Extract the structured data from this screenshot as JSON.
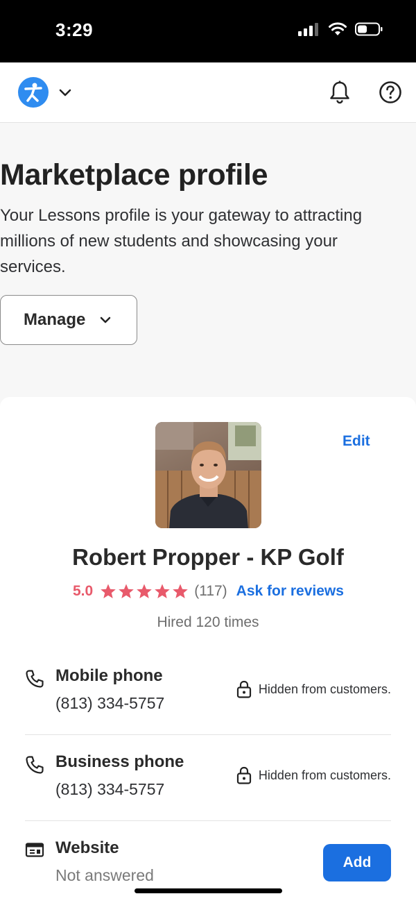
{
  "status_bar": {
    "time": "3:29"
  },
  "header": {
    "logo_icon": "person-logo-icon",
    "menu_icon": "chevron-down-icon",
    "notifications_icon": "bell-icon",
    "help_icon": "question-circle-icon"
  },
  "page": {
    "title": "Marketplace profile",
    "description": "Your Lessons profile is your gateway to attracting millions of new students and showcasing your services.",
    "manage_label": "Manage"
  },
  "profile": {
    "edit_label": "Edit",
    "name": "Robert Propper - KP Golf",
    "rating": "5.0",
    "stars": 5,
    "review_count": "(117)",
    "ask_reviews_label": "Ask for reviews",
    "hired_text": "Hired 120 times"
  },
  "contact": {
    "mobile": {
      "label": "Mobile phone",
      "value": "(813) 334-5757",
      "visibility": "Hidden from customers."
    },
    "business": {
      "label": "Business phone",
      "value": "(813) 334-5757",
      "visibility": "Hidden from customers."
    },
    "website": {
      "label": "Website",
      "value": "Not answered",
      "add_label": "Add"
    }
  },
  "colors": {
    "accent": "#1b6fe0",
    "rating": "#e85a6b",
    "logo": "#2f8cf0"
  }
}
